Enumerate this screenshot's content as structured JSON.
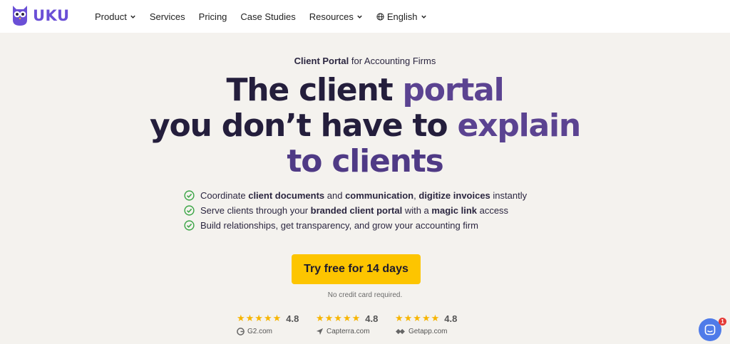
{
  "brand": {
    "name": "UKU",
    "color": "#6a4fd6"
  },
  "nav": {
    "items": [
      {
        "label": "Product",
        "dropdown": true
      },
      {
        "label": "Services",
        "dropdown": false
      },
      {
        "label": "Pricing",
        "dropdown": false
      },
      {
        "label": "Case Studies",
        "dropdown": false
      },
      {
        "label": "Resources",
        "dropdown": true
      },
      {
        "label": "English",
        "dropdown": true,
        "icon": "globe-icon"
      }
    ]
  },
  "hero": {
    "eyebrow_bold": "Client Portal",
    "eyebrow_rest": " for Accounting Firms",
    "headline": {
      "l1a": "The client ",
      "l1b": "portal",
      "l2a": "you don’t have to ",
      "l2b": "explain",
      "l3": "to clients"
    },
    "features": [
      {
        "t1": "Coordinate ",
        "b1": "client documents",
        "t2": " and ",
        "b2": "communication",
        "t3": ", ",
        "b3": "digitize invoices",
        "t4": " instantly"
      },
      {
        "t1": "Serve clients through your ",
        "b1": "branded client portal",
        "t2": " with a ",
        "b2": "magic link",
        "t3": " access"
      },
      {
        "t1": "Build relationships, get transparency, and grow your accounting firm"
      }
    ],
    "cta_label": "Try free for 14 days",
    "cta_note": "No credit card required."
  },
  "ratings": [
    {
      "stars": "★★★★★",
      "score": "4.8",
      "source": "G2.com",
      "icon": "g2-icon"
    },
    {
      "stars": "★★★★★",
      "score": "4.8",
      "source": "Capterra.com",
      "icon": "capterra-icon"
    },
    {
      "stars": "★★★★★",
      "score": "4.8",
      "source": "Getapp.com",
      "icon": "getapp-icon"
    }
  ],
  "chat": {
    "badge": "1"
  },
  "colors": {
    "accent": "#fdc500",
    "headline_dark": "#241e3c",
    "headline_purple": "#5b4391",
    "check_green": "#3aa545",
    "star": "#f7b500"
  }
}
